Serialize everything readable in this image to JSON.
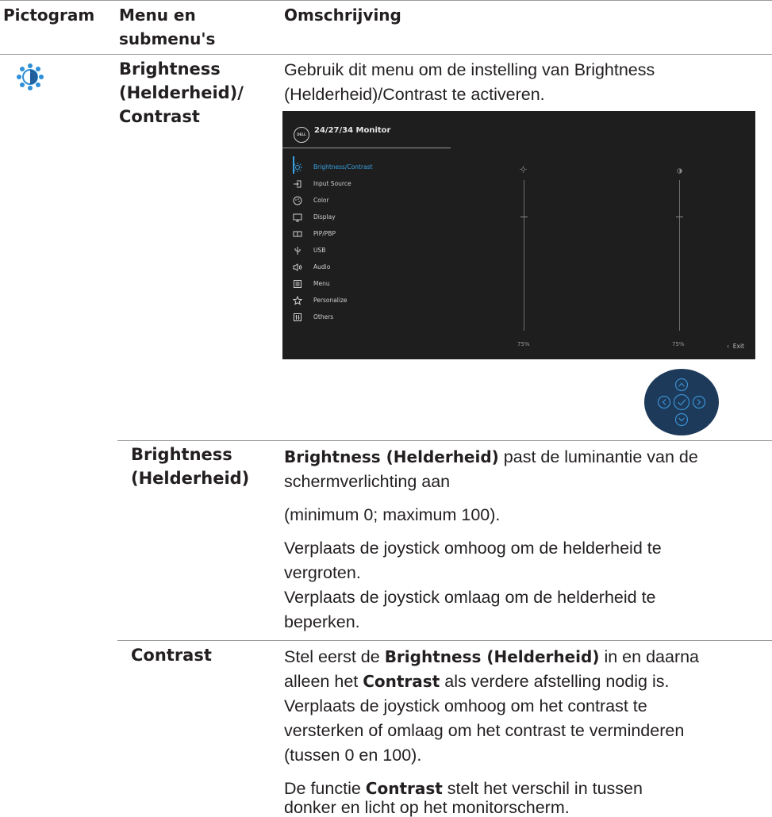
{
  "header": {
    "col1": "Pictogram",
    "col2_line1": "Menu en",
    "col2_line2": "submenu's",
    "col3": "Omschrijving"
  },
  "section_brightness_contrast": {
    "icon": "brightness-contrast-icon",
    "menu_line1": "Brightness",
    "menu_line2": "(Helderheid)/",
    "menu_line3": "Contrast",
    "desc_line1": "Gebruik dit menu om de instelling van Brightness",
    "desc_line2": "(Helderheid)/Contrast te activeren."
  },
  "osd": {
    "logo": "DELL",
    "title": "24/27/34 Monitor",
    "menu_items": [
      {
        "label": "Brightness/Contrast",
        "icon": "sun-icon"
      },
      {
        "label": "Input Source",
        "icon": "input-icon"
      },
      {
        "label": "Color",
        "icon": "palette-icon"
      },
      {
        "label": "Display",
        "icon": "display-icon"
      },
      {
        "label": "PIP/PBP",
        "icon": "pip-icon"
      },
      {
        "label": "USB",
        "icon": "usb-icon"
      },
      {
        "label": "Audio",
        "icon": "speaker-icon"
      },
      {
        "label": "Menu",
        "icon": "menu-icon"
      },
      {
        "label": "Personalize",
        "icon": "star-icon"
      },
      {
        "label": "Others",
        "icon": "others-icon"
      }
    ],
    "brightness_value": "75%",
    "contrast_value": "75%",
    "brightness_level": 75,
    "contrast_level": 75,
    "exit_label": "Exit",
    "accent_color": "#3aa0e0"
  },
  "joystick": {
    "icon": "joystick-icon",
    "color": "#1d3a5a",
    "outline_color": "#3a8fd0"
  },
  "brightness": {
    "label_line1": "Brightness",
    "label_line2": "(Helderheid)",
    "p1_bold": "Brightness (Helderheid)",
    "p1_rest": " past de luminantie van de",
    "p1_line2": "schermverlichting aan",
    "p2": "(minimum 0; maximum 100).",
    "p3_line1": "Verplaats de joystick omhoog om de helderheid te",
    "p3_line2": "vergroten.",
    "p4_line1": "Verplaats de joystick omlaag om de helderheid te",
    "p4_line2": "beperken."
  },
  "contrast": {
    "label": "Contrast",
    "l1_a": "Stel eerst de ",
    "l1_b": "Brightness (Helderheid)",
    "l1_c": " in en daarna",
    "l2_a": "alleen het ",
    "l2_b": "Contrast",
    "l2_c": " als verdere afstelling nodig is.",
    "l3": "Verplaats de joystick omhoog om het contrast te",
    "l4": "versterken of omlaag om het contrast te verminderen",
    "l5": "(tussen 0 en 100).",
    "l6_a": "De functie ",
    "l6_b": "Contrast",
    "l6_c": " stelt het verschil in tussen",
    "l7": "donker en licht op het monitorscherm."
  }
}
